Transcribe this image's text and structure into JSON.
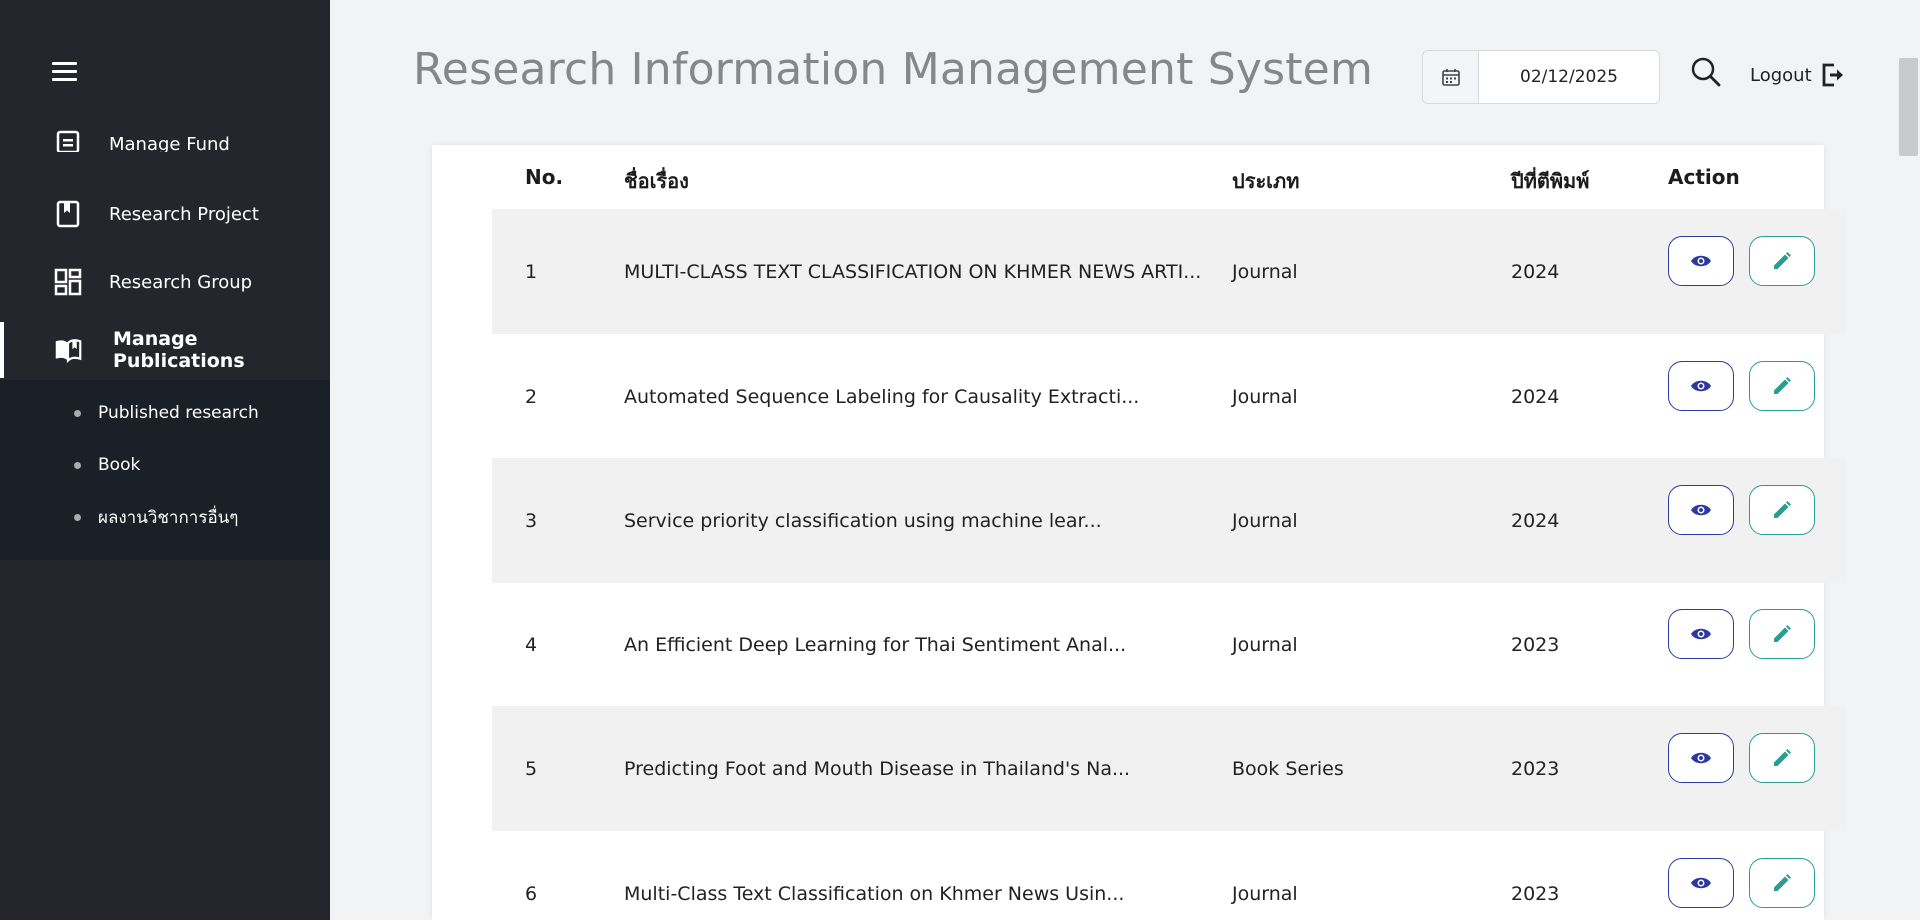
{
  "sidebar": {
    "menu_icon": "hamburger-icon",
    "items": [
      {
        "label": "Manage Fund",
        "icon": "document-icon"
      },
      {
        "label": "Research Project",
        "icon": "bookmark-icon"
      },
      {
        "label": "Research Group",
        "icon": "dashboard-icon"
      },
      {
        "label": "Manage Publications",
        "icon": "open-book-icon",
        "active": true
      }
    ],
    "submenu": [
      {
        "label": "Published research"
      },
      {
        "label": "Book"
      },
      {
        "label": "ผลงานวิชาการอื่นๆ"
      }
    ]
  },
  "header": {
    "title": "Research Information Management System",
    "date_value": "02/12/2025",
    "logout_label": "Logout"
  },
  "table": {
    "columns": [
      "No.",
      "ชื่อเรื่อง",
      "ประเภท",
      "ปีที่ตีพิมพ์",
      "Action"
    ],
    "rows": [
      {
        "no": "1",
        "title": "MULTI-CLASS TEXT CLASSIFICATION ON KHMER NEWS ARTI...",
        "type": "Journal",
        "year": "2024"
      },
      {
        "no": "2",
        "title": "Automated Sequence Labeling for Causality Extracti...",
        "type": "Journal",
        "year": "2024"
      },
      {
        "no": "3",
        "title": "Service priority classification using machine lear...",
        "type": "Journal",
        "year": "2024"
      },
      {
        "no": "4",
        "title": "An Efficient Deep Learning for Thai Sentiment Anal...",
        "type": "Journal",
        "year": "2023"
      },
      {
        "no": "5",
        "title": "Predicting Foot and Mouth Disease in Thailand's Na...",
        "type": "Book Series",
        "year": "2023"
      },
      {
        "no": "6",
        "title": "Multi-Class Text Classification on Khmer News Usin...",
        "type": "Journal",
        "year": "2023"
      }
    ]
  },
  "colors": {
    "sidebar_bg": "#25262b",
    "submenu_bg": "#1b1f27",
    "view_button": "#2c3aa0",
    "edit_button": "#2a9d8f"
  }
}
